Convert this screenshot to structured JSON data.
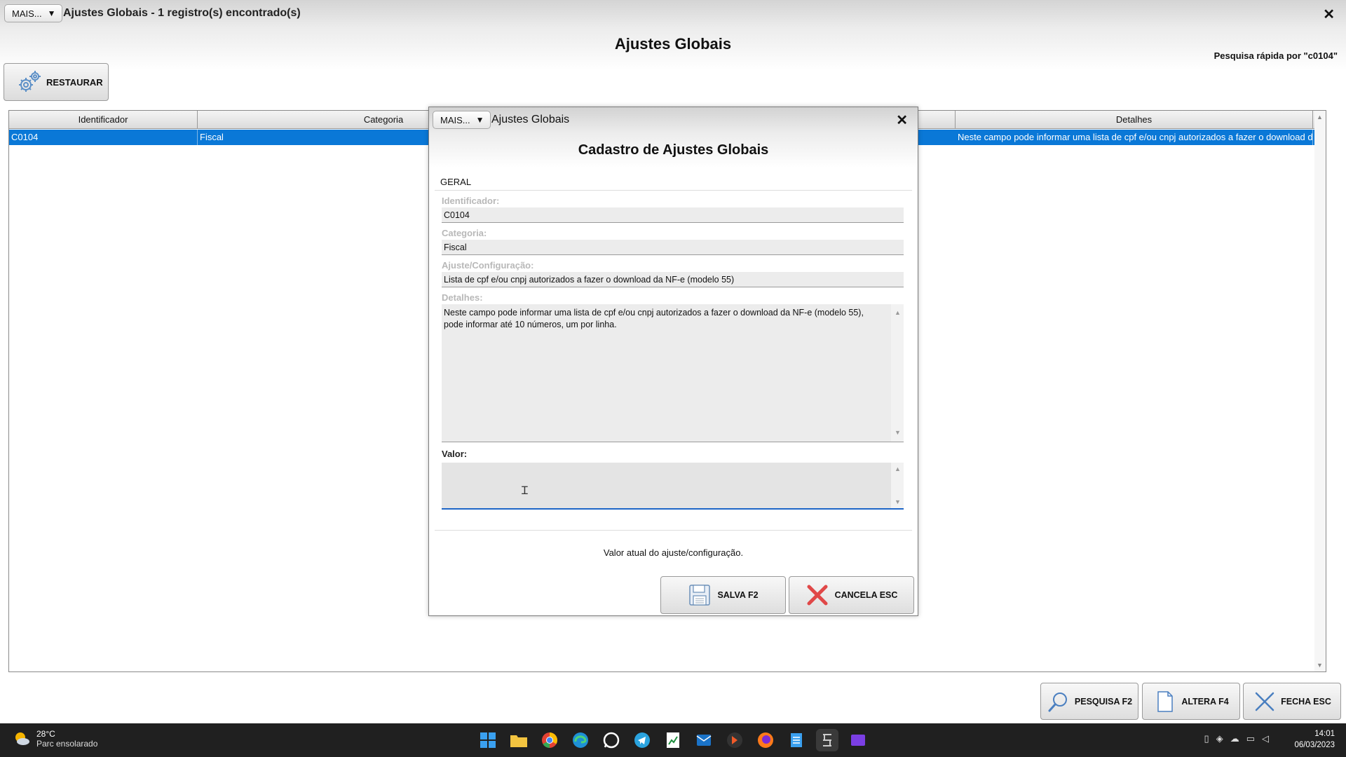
{
  "window": {
    "mais_label": "MAIS...",
    "title": "Ajustes Globais - 1 registro(s) encontrado(s)",
    "close_glyph": "✕",
    "heading": "Ajustes Globais",
    "quick_search": "Pesquisa rápida por \"c0104\""
  },
  "toolbar": {
    "restore_label": "RESTAURAR",
    "restore_icon": "gears-icon"
  },
  "grid": {
    "columns": [
      "Identificador",
      "Categoria",
      "Detalhes"
    ],
    "rows": [
      {
        "identificador": "C0104",
        "categoria": "Fiscal",
        "detalhes": "Neste campo pode informar uma lista de cpf e/ou cnpj autorizados a fazer o download da NF"
      }
    ],
    "selected_color": "#0a78d7"
  },
  "dialog": {
    "mais_label": "MAIS...",
    "title": "Ajustes Globais",
    "heading": "Cadastro de Ajustes Globais",
    "tab": "GERAL",
    "fields": {
      "identificador_label": "Identificador:",
      "identificador_value": "C0104",
      "categoria_label": "Categoria:",
      "categoria_value": "Fiscal",
      "ajuste_label": "Ajuste/Configuração:",
      "ajuste_value": "Lista de cpf e/ou cnpj autorizados a fazer o download da NF-e (modelo 55)",
      "detalhes_label": "Detalhes:",
      "detalhes_value": "Neste campo pode informar uma lista de cpf e/ou cnpj autorizados a fazer o download da NF-e (modelo 55),\npode informar até 10 números, um por linha.",
      "valor_label": "Valor:",
      "valor_value": ""
    },
    "hint": "Valor atual do ajuste/configuração.",
    "save_label": "SALVA F2",
    "cancel_label": "CANCELA ESC"
  },
  "bottom_bar": {
    "search_label": "PESQUISA F2",
    "edit_label": "ALTERA F4",
    "close_label": "FECHA ESC"
  },
  "taskbar": {
    "temperature": "28°C",
    "weather": "Parc ensolarado",
    "time": "14:01",
    "date": "06/03/2023"
  }
}
